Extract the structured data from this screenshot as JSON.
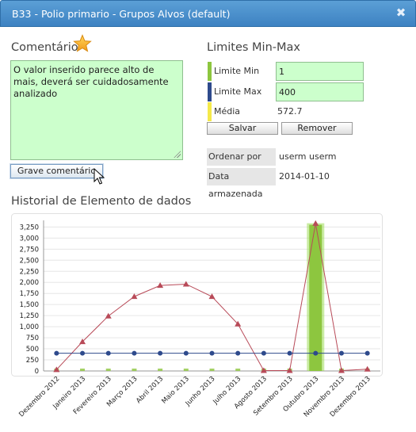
{
  "window": {
    "title": "B33 - Polio primario - Grupos Alvos (default)",
    "close_glyph": "✖"
  },
  "comment": {
    "heading": "Comentário",
    "text": "O valor inserido parece alto de mais, deverá ser cuidadosamente analizado",
    "save_label": "Grave comentário"
  },
  "limits": {
    "heading": "Limites Min-Max",
    "min_label": "Limite Min",
    "min_value": "1",
    "max_label": "Limite Max",
    "max_value": "400",
    "avg_label": "Média",
    "avg_value": "572.7",
    "save_label": "Salvar",
    "remove_label": "Remover",
    "colors": {
      "min": "#8dc63f",
      "max": "#2e4a8c",
      "avg": "#f5e94a"
    }
  },
  "info": {
    "order_label": "Ordenar por",
    "order_value": "userm userm",
    "stored_label": "Data armazenada",
    "stored_value": "2014-01-10"
  },
  "chart": {
    "heading": "Historial de Elemento de dados"
  },
  "chart_data": {
    "type": "line",
    "categories": [
      "Dezembro 2012",
      "Janeiro 2013",
      "Fevereiro 2013",
      "Março 2013",
      "Abril 2013",
      "Maio 2013",
      "Junho 2013",
      "Julho 2013",
      "Agosto 2013",
      "Setembro 2013",
      "Outubro 2013",
      "Novembro 2013",
      "Dezembro 2013"
    ],
    "series": [
      {
        "values": [
          30,
          660,
          1240,
          1680,
          1930,
          1960,
          1680,
          1060,
          10,
          10,
          3330,
          10,
          40
        ],
        "color": "#b84a58",
        "marker": "triangle"
      },
      {
        "values": [
          400,
          400,
          400,
          400,
          400,
          400,
          400,
          400,
          400,
          400,
          400,
          400,
          400
        ],
        "color": "#2e4a8c",
        "marker": "circle"
      }
    ],
    "bars": {
      "values": [
        0,
        0,
        0,
        0,
        0,
        0,
        0,
        0,
        0,
        0,
        3300,
        0,
        0
      ],
      "color": "#8dc63f"
    },
    "ylim": [
      0,
      3400
    ],
    "yticks": [
      "0",
      "250",
      "500",
      "750",
      "1,000",
      "1,250",
      "1,500",
      "1,750",
      "2,000",
      "2,250",
      "2,500",
      "2,750",
      "3,000",
      "3,250"
    ],
    "grid": true
  }
}
